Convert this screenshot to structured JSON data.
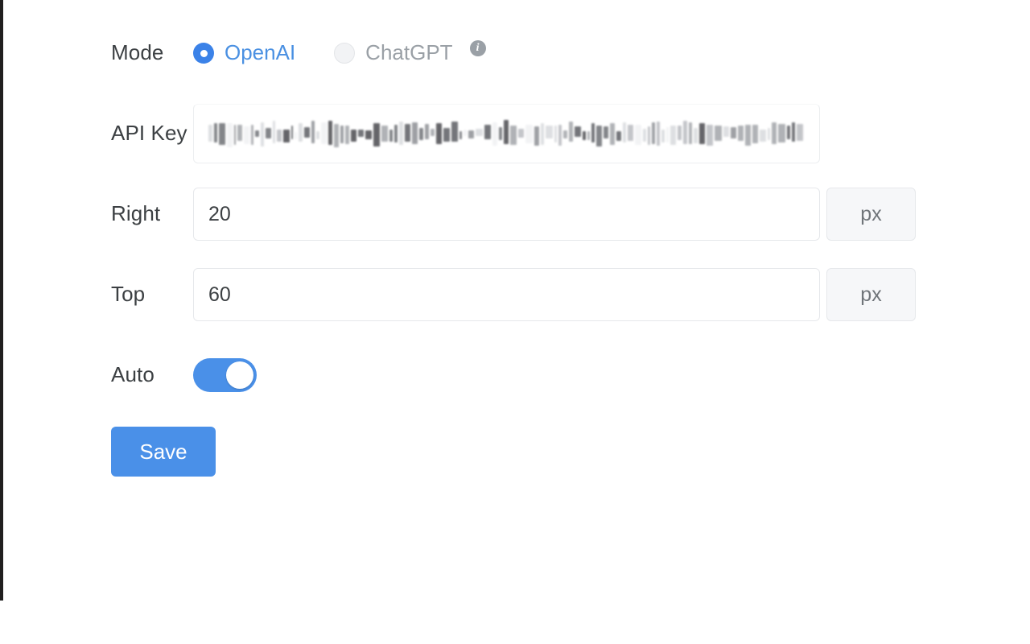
{
  "panel": {
    "accent_color": "#4a90e8",
    "selected_color": "#4a90e2",
    "muted_color": "#9aa0a6",
    "label_color": "#3c4043"
  },
  "rows": {
    "mode": {
      "label": "Mode",
      "options": [
        {
          "label": "OpenAI",
          "selected": true,
          "info": false
        },
        {
          "label": "ChatGPT",
          "selected": false,
          "info": true,
          "info_glyph": "i"
        }
      ]
    },
    "api_key": {
      "label": "API Key",
      "value": "••••••••••••••••••••••••••••••••••••••••••••••••••",
      "placeholder": "",
      "redacted": true
    },
    "right": {
      "label": "Right",
      "value": "20",
      "placeholder": "",
      "unit": "px"
    },
    "top": {
      "label": "Top",
      "value": "60",
      "placeholder": "",
      "unit": "px"
    },
    "auto": {
      "label": "Auto",
      "enabled": true,
      "state_text": "on"
    }
  },
  "actions": {
    "save_label": "Save"
  }
}
